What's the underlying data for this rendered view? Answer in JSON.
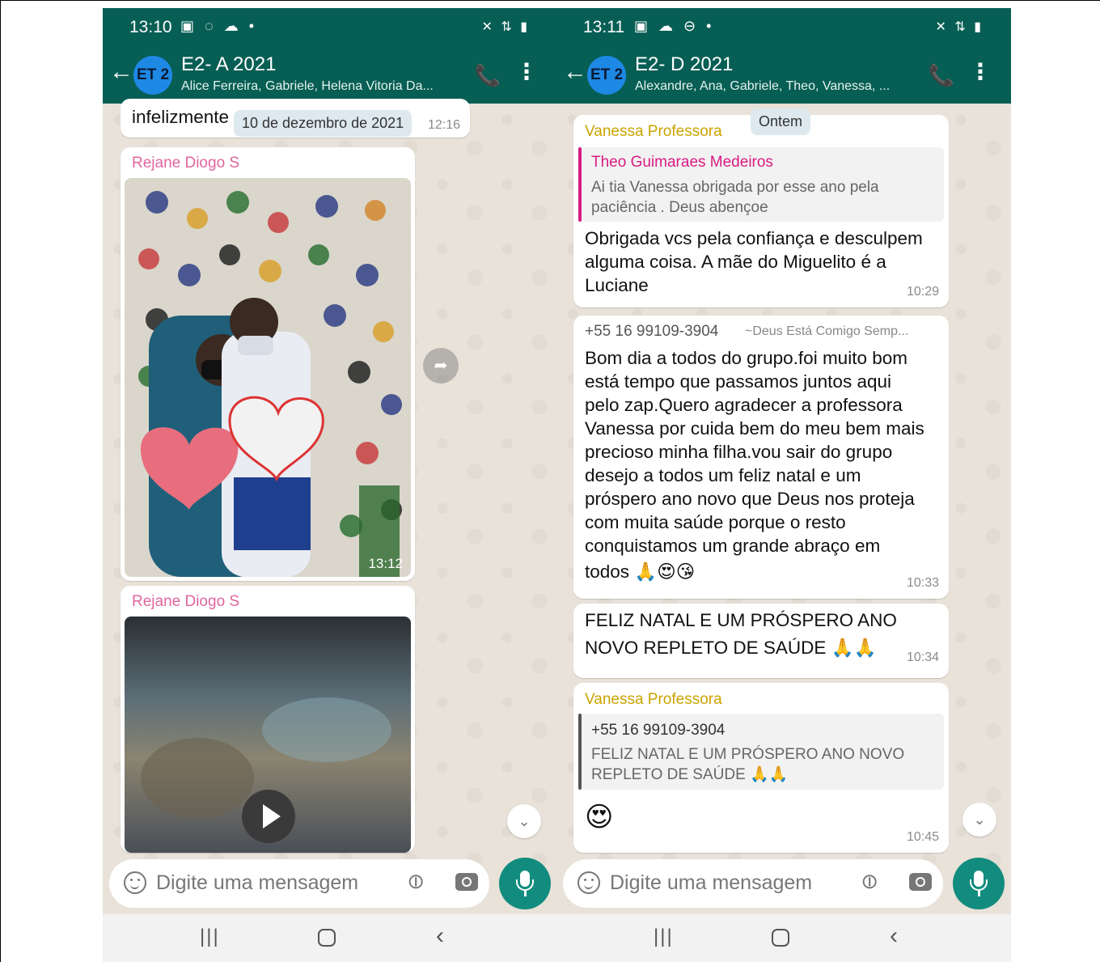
{
  "left_phone": {
    "status": {
      "time": "13:10",
      "left_icons": "▣ ◌ ☁ •",
      "right_icons": "✕ ⇅ ▮"
    },
    "header": {
      "avatar": "ET 2",
      "title": "E2- A 2021",
      "subtitle": "Alice Ferreira, Gabriele, Helena Vitoria Da..."
    },
    "partial_message": {
      "text": "infelizmente",
      "time": "12:16"
    },
    "date_pill": "10 de dezembro de 2021",
    "messages": [
      {
        "sender": "Rejane Diogo S",
        "type": "photo",
        "time": "13:12"
      },
      {
        "sender": "Rejane Diogo S",
        "type": "video"
      }
    ],
    "input": {
      "placeholder": "Digite uma mensagem"
    }
  },
  "right_phone": {
    "status": {
      "time": "13:11",
      "left_icons": "▣ ☁ ⊖ •",
      "right_icons": "✕ ⇅ ▮"
    },
    "header": {
      "avatar": "ET 2",
      "title": "E2- D 2021",
      "subtitle": "Alexandre, Ana, Gabriele, Theo, Vanessa, ..."
    },
    "date_pill": "Ontem",
    "messages": [
      {
        "sender": "Vanessa Professora",
        "quote_name": "Theo Guimaraes Medeiros",
        "quote_lines": [
          "Ai tia Vanessa obrigada por esse ano pela",
          "paciência . Deus abençoe"
        ],
        "lines": [
          "Obrigada vcs pela confiança e desculpem",
          "alguma coisa. A mãe do Miguelito é a",
          "Luciane"
        ],
        "time": "10:29"
      },
      {
        "sender": "+55 16 99109-3904",
        "sender_alias": "~Deus Está Comigo Semp...",
        "lines": [
          "Bom dia a todos do grupo.foi muito bom",
          "está tempo que passamos juntos aqui",
          "pelo zap.Quero agradecer a professora",
          "Vanessa por cuida bem do meu bem mais",
          "precioso minha filha.vou sair do grupo",
          "desejo a todos um feliz natal e um",
          "próspero ano novo que Deus nos proteja",
          "com muita saúde porque o resto",
          "conquistamos um grande abraço em",
          "todos 🙏😍😘"
        ],
        "time": "10:33"
      },
      {
        "lines": [
          "FELIZ NATAL E UM PRÓSPERO ANO",
          "NOVO REPLETO DE SAÚDE 🙏🙏"
        ],
        "time": "10:34"
      },
      {
        "sender": "Vanessa Professora",
        "quote_name": "+55 16 99109-3904",
        "quote_lines": [
          "FELIZ NATAL E UM PRÓSPERO ANO NOVO",
          "REPLETO DE SAÚDE 🙏🙏"
        ],
        "lines": [
          "😍"
        ],
        "time": "10:45"
      }
    ],
    "input": {
      "placeholder": "Digite uma mensagem"
    }
  },
  "colors": {
    "header_green": "#075e54",
    "mic_green": "#128c7e",
    "sender_pink": "#e0669e",
    "sender_yellow": "#c9a400",
    "quote_pink": "#d81b82",
    "quote_gray": "#555555"
  },
  "icons": [
    "back-arrow-icon",
    "add-call-icon",
    "more-vert-icon",
    "emoji-icon",
    "attach-clip-icon",
    "camera-icon",
    "mic-icon",
    "forward-icon",
    "scroll-down-icon",
    "play-icon"
  ]
}
